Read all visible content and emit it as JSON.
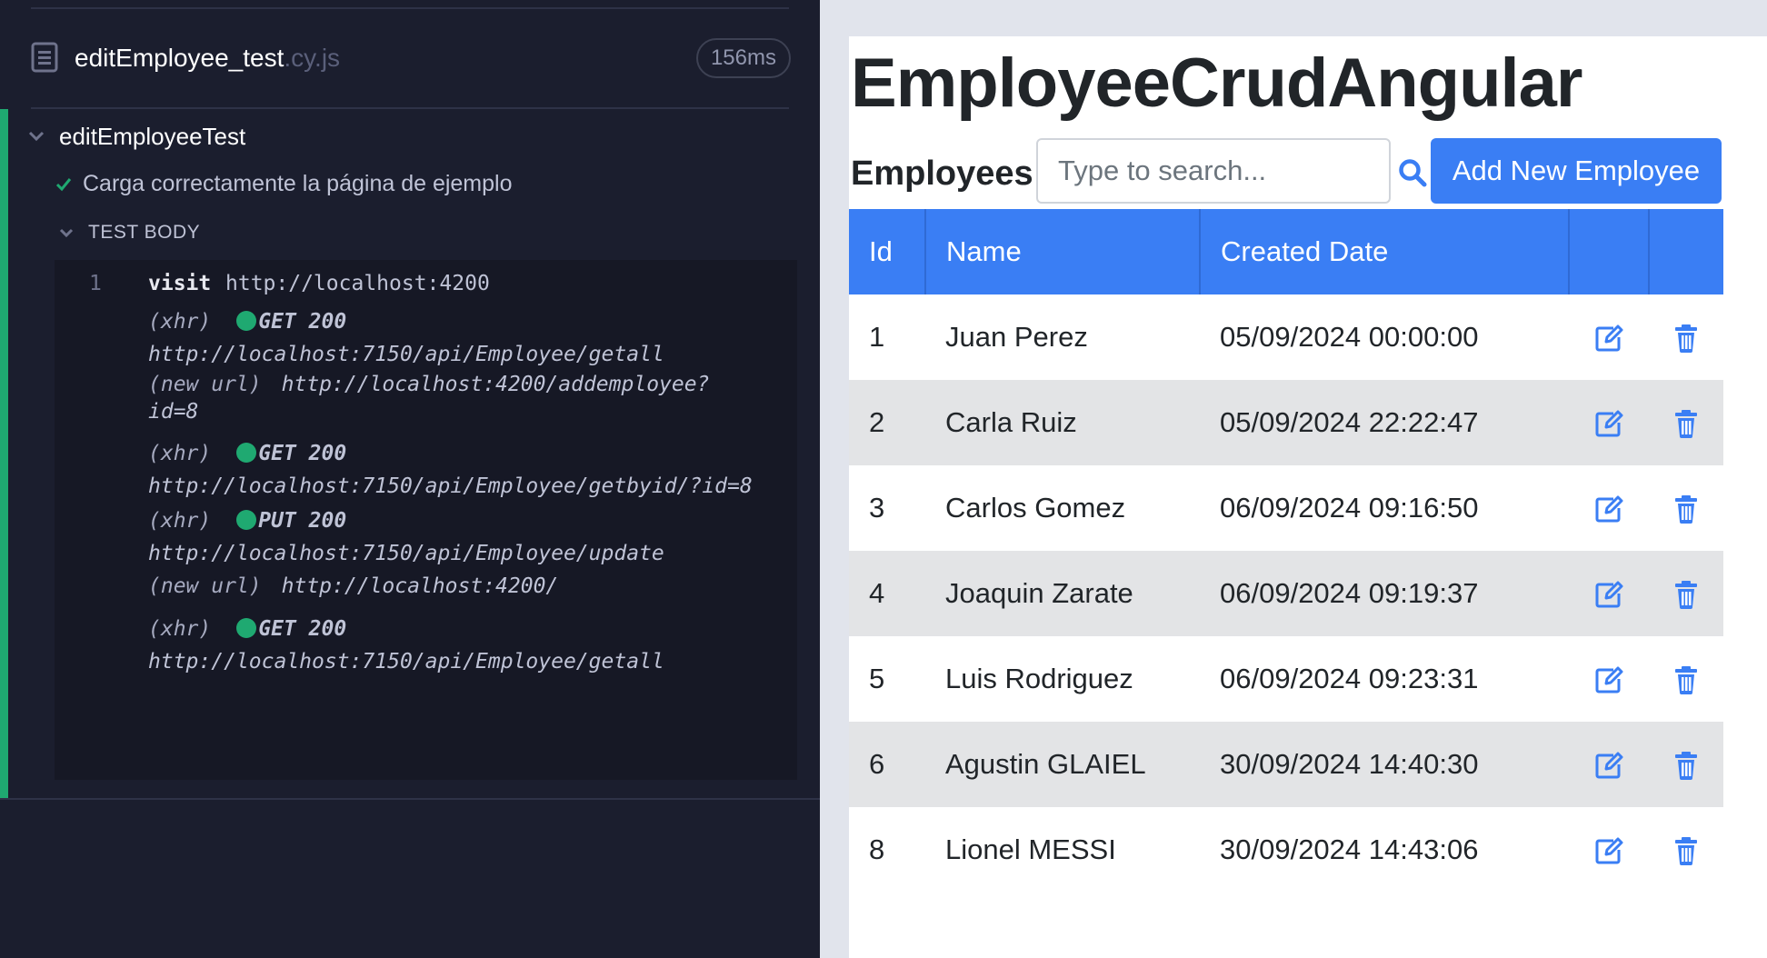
{
  "runner": {
    "spec_name": "editEmployee_test",
    "spec_ext": ".cy.js",
    "duration": "156ms",
    "suite_title": "editEmployeeTest",
    "test_title": "Carga correctamente la página de ejemplo",
    "body_label": "TEST BODY",
    "commands": [
      {
        "number": "1",
        "name": "visit",
        "message": "http://localhost:4200"
      }
    ],
    "events": [
      {
        "type": "(xhr)",
        "method": "GET 200",
        "url": "http://localhost:7150/api/Employee/getall"
      },
      {
        "type": "(new url)",
        "url_line1": "http://localhost:4200/addemployee?",
        "url_line2": "id=8"
      },
      {
        "type": "(xhr)",
        "method": "GET 200",
        "url": "http://localhost:7150/api/Employee/getbyid/?id=8"
      },
      {
        "type": "(xhr)",
        "method": "PUT 200",
        "url": "http://localhost:7150/api/Employee/update"
      },
      {
        "type": "(new url)",
        "url": "http://localhost:4200/"
      },
      {
        "type": "(xhr)",
        "method": "GET 200",
        "url": "http://localhost:7150/api/Employee/getall"
      }
    ],
    "colors": {
      "pass": "#1fa971",
      "background": "#1b1e2e"
    }
  },
  "app": {
    "title": "EmployeeCrudAngular",
    "employees_label": "Employees:",
    "search_placeholder": "Type to search...",
    "add_button": "Add New Employee",
    "table": {
      "headers": [
        "Id",
        "Name",
        "Created Date"
      ],
      "rows": [
        {
          "id": "1",
          "name": "Juan Perez",
          "created": "05/09/2024 00:00:00"
        },
        {
          "id": "2",
          "name": "Carla Ruiz",
          "created": "05/09/2024 22:22:47"
        },
        {
          "id": "3",
          "name": "Carlos Gomez",
          "created": "06/09/2024 09:16:50"
        },
        {
          "id": "4",
          "name": "Joaquin Zarate",
          "created": "06/09/2024 09:19:37"
        },
        {
          "id": "5",
          "name": "Luis Rodriguez",
          "created": "06/09/2024 09:23:31"
        },
        {
          "id": "6",
          "name": "Agustin GLAIEL",
          "created": "30/09/2024 14:40:30"
        },
        {
          "id": "8",
          "name": "Lionel MESSI",
          "created": "30/09/2024 14:43:06"
        }
      ],
      "row_actions": [
        "edit-icon",
        "trash-icon"
      ]
    },
    "colors": {
      "primary": "#3a7ef4",
      "stripe": "#e3e4e6"
    }
  }
}
